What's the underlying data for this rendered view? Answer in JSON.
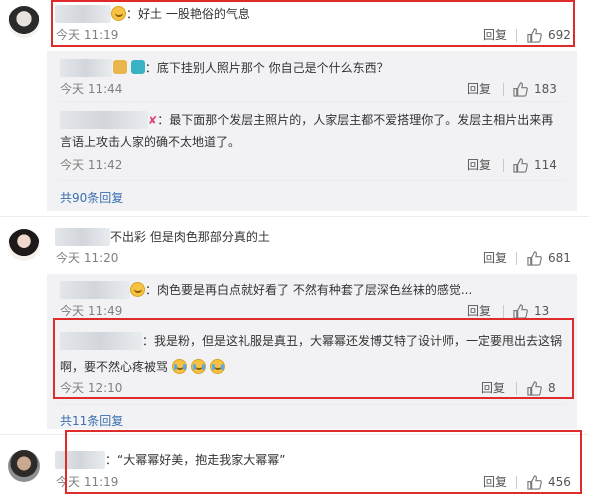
{
  "comments": [
    {
      "text": "：好土 一股艳俗的气息",
      "time": "今天 11:19",
      "reply_label": "回复",
      "likes": "692",
      "replies": [
        {
          "text": "：底下挂别人照片那个 你自己是个什么东西？",
          "time": "今天 11:44",
          "reply_label": "回复",
          "likes": "183"
        },
        {
          "text_line1": "：最下面那个发层主照片的，人家层主都不爱搭理你了。发层主相片出来再",
          "text_line2": "言语上攻击人家的确不太地道了。",
          "time": "今天 11:42",
          "reply_label": "回复",
          "likes": "114"
        }
      ],
      "more_replies": "共90条回复"
    },
    {
      "text": "不出彩 但是肉色那部分真的土",
      "time": "今天 11:20",
      "reply_label": "回复",
      "likes": "681",
      "replies": [
        {
          "text": "：肉色要是再白点就好看了 不然有种套了层深色丝袜的感觉...",
          "time": "今天 11:49",
          "reply_label": "回复",
          "likes": "13"
        },
        {
          "text_line1": "：我是粉，但是这礼服是真丑，大幂幂还发博艾特了设计师，一定要甩出去这锅",
          "text_line2": "啊，要不然心疼被骂",
          "time": "今天 12:10",
          "reply_label": "回复",
          "likes": "8"
        }
      ],
      "more_replies": "共11条回复"
    },
    {
      "text": "：“大幂幂好美，抱走我家大幂幂”",
      "time": "今天 11:19",
      "reply_label": "回复",
      "likes": "456"
    }
  ],
  "colors": {
    "highlight": "#e02b2b",
    "link": "#3a6fb0",
    "reply_bg": "#f2f2f5"
  },
  "icons": {
    "like": "thumbs-up-icon",
    "emoji": "laugh-cry-emoji-icon"
  }
}
